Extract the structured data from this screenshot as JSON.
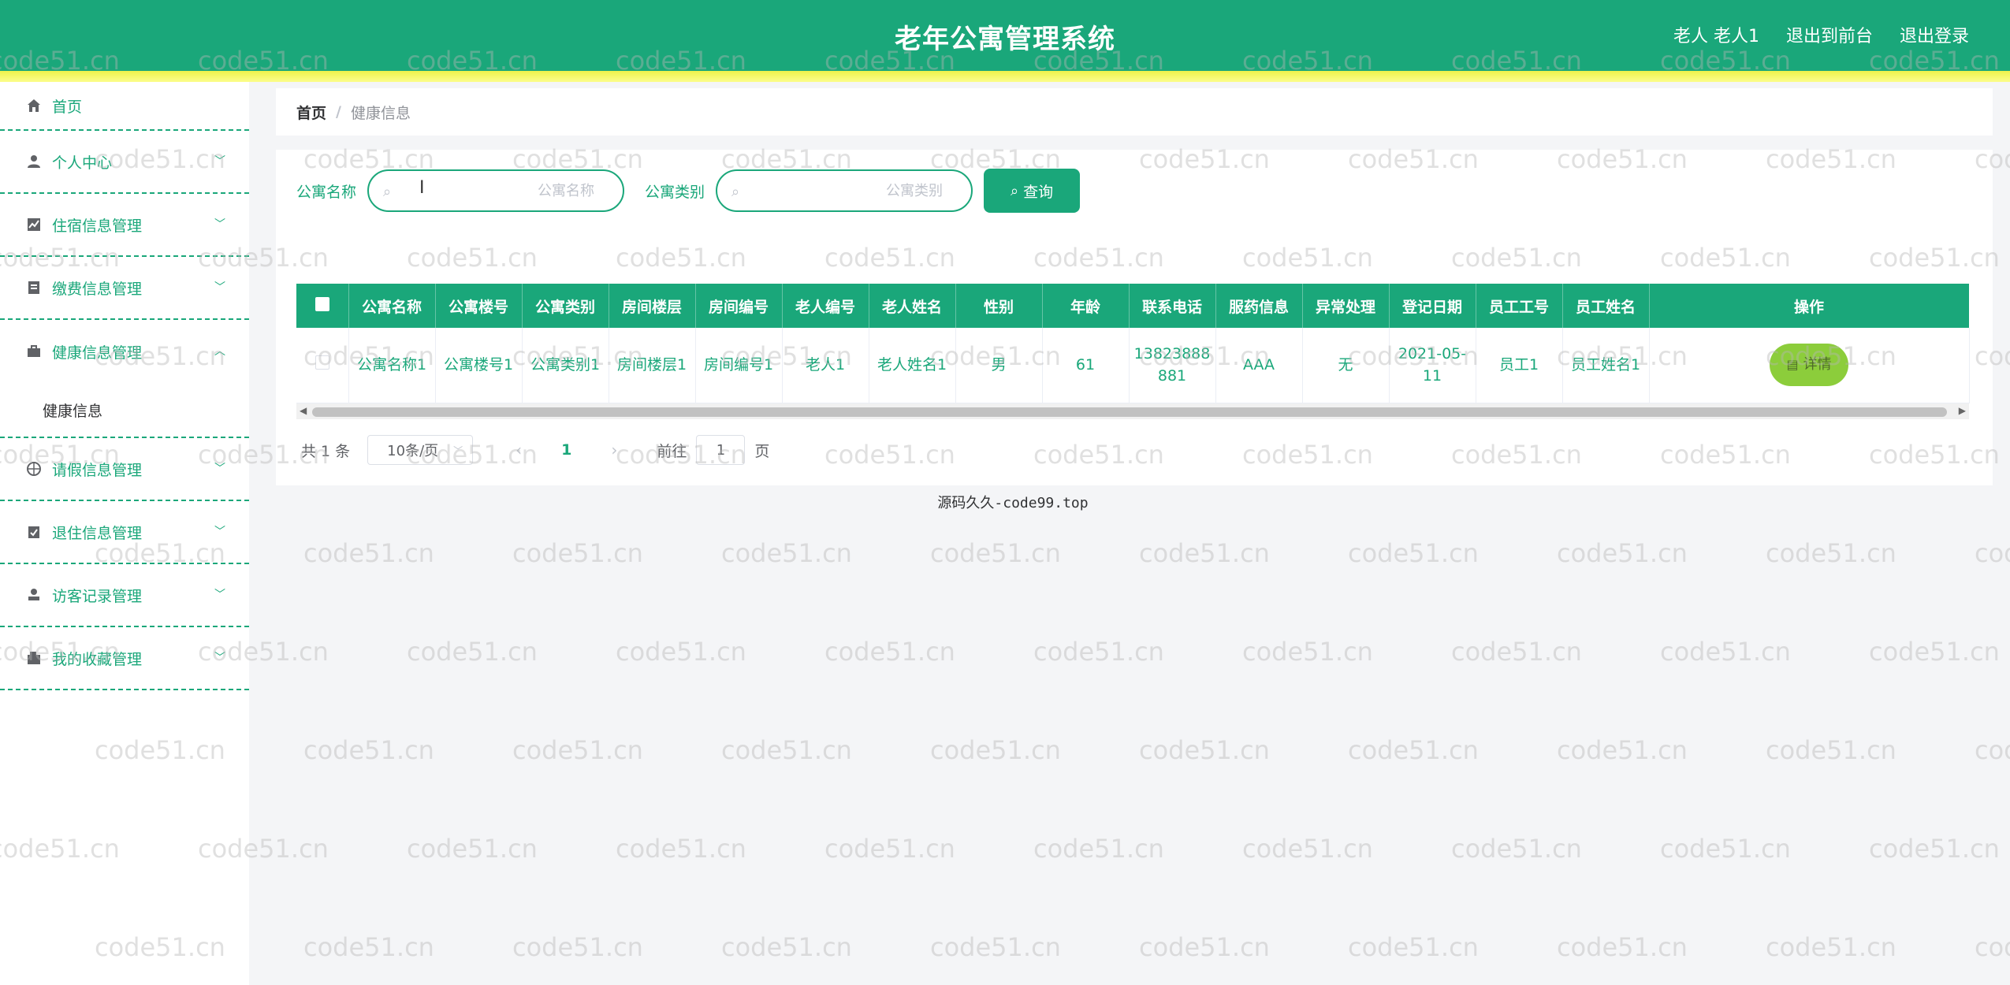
{
  "app": {
    "title": "老年公寓管理系统",
    "user_label": "老人 老人1",
    "to_front_label": "退出到前台",
    "logout_label": "退出登录",
    "brand_color": "#1aa77a"
  },
  "sidebar": {
    "items": [
      {
        "label": "首页",
        "icon": "home-icon",
        "expandable": false
      },
      {
        "label": "个人中心",
        "icon": "user-icon",
        "expandable": true
      },
      {
        "label": "住宿信息管理",
        "icon": "chart-icon",
        "expandable": true
      },
      {
        "label": "缴费信息管理",
        "icon": "document-icon",
        "expandable": true
      },
      {
        "label": "健康信息管理",
        "icon": "briefcase-icon",
        "expandable": true,
        "open": true
      },
      {
        "label": "请假信息管理",
        "icon": "globe-icon",
        "expandable": true
      },
      {
        "label": "退住信息管理",
        "icon": "clipboard-icon",
        "expandable": true
      },
      {
        "label": "访客记录管理",
        "icon": "person-icon",
        "expandable": true
      },
      {
        "label": "我的收藏管理",
        "icon": "wallet-icon",
        "expandable": true
      }
    ],
    "submenu_health": "健康信息"
  },
  "breadcrumb": {
    "home": "首页",
    "separator": "/",
    "current": "健康信息"
  },
  "search": {
    "field1_label": "公寓名称",
    "field1_placeholder": "公寓名称",
    "field2_label": "公寓类别",
    "field2_placeholder": "公寓类别",
    "query_label": "查询"
  },
  "table": {
    "columns": [
      "公寓名称",
      "公寓楼号",
      "公寓类别",
      "房间楼层",
      "房间编号",
      "老人编号",
      "老人姓名",
      "性别",
      "年龄",
      "联系电话",
      "服药信息",
      "异常处理",
      "登记日期",
      "员工工号",
      "员工姓名",
      "操作"
    ],
    "rows": [
      {
        "cells": [
          "公寓名称1",
          "公寓楼号1",
          "公寓类别1",
          "房间楼层1",
          "房间编号1",
          "老人1",
          "老人姓名1",
          "男",
          "61",
          "13823888881",
          "AAA",
          "无",
          "2021-05-11",
          "员工1",
          "员工姓名1"
        ],
        "action_label": "详情"
      }
    ]
  },
  "pagination": {
    "total": "共 1 条",
    "page_size": "10条/页",
    "current_page": "1",
    "goto_label": "前往",
    "goto_value": "1",
    "page_suffix": "页"
  },
  "footer": "源码久久-code99.top",
  "watermark": "code51.cn"
}
